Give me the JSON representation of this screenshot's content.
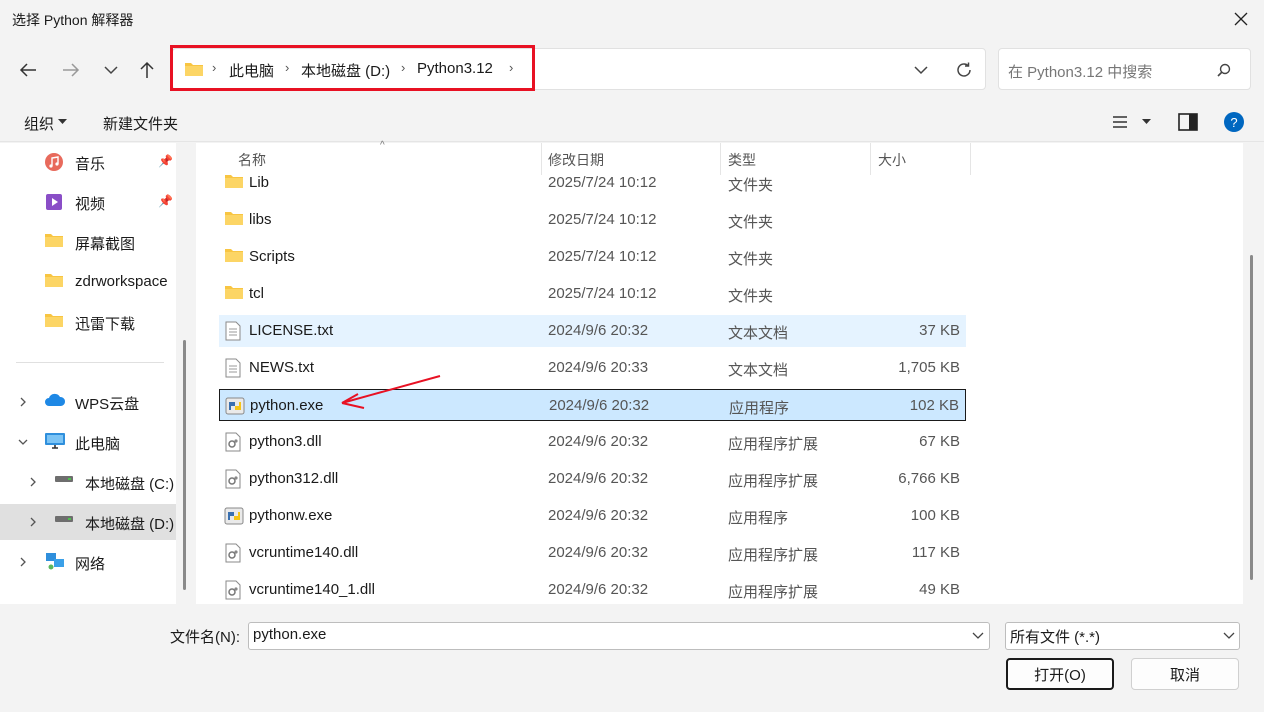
{
  "window": {
    "title": "选择 Python 解释器"
  },
  "breadcrumb": [
    "此电脑",
    "本地磁盘 (D:)",
    "Python3.12"
  ],
  "search": {
    "placeholder": "在 Python3.12 中搜索"
  },
  "toolbar": {
    "organize": "组织",
    "new_folder": "新建文件夹"
  },
  "nav": {
    "items": [
      {
        "label": "音乐",
        "icon": "music-icon",
        "pinned": true
      },
      {
        "label": "视频",
        "icon": "video-icon",
        "pinned": true
      },
      {
        "label": "屏幕截图",
        "icon": "folder-icon"
      },
      {
        "label": "zdrworkspace",
        "icon": "folder-icon"
      },
      {
        "label": "迅雷下载",
        "icon": "folder-icon"
      },
      {
        "label": "WPS云盘",
        "icon": "cloud-icon",
        "expandable": true
      },
      {
        "label": "此电脑",
        "icon": "computer-icon",
        "expanded": true
      },
      {
        "label": "本地磁盘 (C:)",
        "icon": "drive-icon",
        "expandable": true
      },
      {
        "label": "本地磁盘 (D:)",
        "icon": "drive-icon",
        "expandable": true,
        "selected": true
      },
      {
        "label": "网络",
        "icon": "network-icon",
        "expandable": true
      }
    ]
  },
  "columns": {
    "name": "名称",
    "date": "修改日期",
    "type": "类型",
    "size": "大小"
  },
  "files": [
    {
      "name": "Lib",
      "date": "2025/7/24 10:12",
      "type": "文件夹",
      "size": "",
      "icon": "folder-icon"
    },
    {
      "name": "libs",
      "date": "2025/7/24 10:12",
      "type": "文件夹",
      "size": "",
      "icon": "folder-icon"
    },
    {
      "name": "Scripts",
      "date": "2025/7/24 10:12",
      "type": "文件夹",
      "size": "",
      "icon": "folder-icon"
    },
    {
      "name": "tcl",
      "date": "2025/7/24 10:12",
      "type": "文件夹",
      "size": "",
      "icon": "folder-icon"
    },
    {
      "name": "LICENSE.txt",
      "date": "2024/9/6 20:32",
      "type": "文本文档",
      "size": "37 KB",
      "icon": "text-file-icon"
    },
    {
      "name": "NEWS.txt",
      "date": "2024/9/6 20:33",
      "type": "文本文档",
      "size": "1,705 KB",
      "icon": "text-file-icon"
    },
    {
      "name": "python.exe",
      "date": "2024/9/6 20:32",
      "type": "应用程序",
      "size": "102 KB",
      "icon": "python-icon"
    },
    {
      "name": "python3.dll",
      "date": "2024/9/6 20:32",
      "type": "应用程序扩展",
      "size": "67 KB",
      "icon": "dll-icon"
    },
    {
      "name": "python312.dll",
      "date": "2024/9/6 20:32",
      "type": "应用程序扩展",
      "size": "6,766 KB",
      "icon": "dll-icon"
    },
    {
      "name": "pythonw.exe",
      "date": "2024/9/6 20:32",
      "type": "应用程序",
      "size": "100 KB",
      "icon": "python-icon"
    },
    {
      "name": "vcruntime140.dll",
      "date": "2024/9/6 20:32",
      "type": "应用程序扩展",
      "size": "117 KB",
      "icon": "dll-icon"
    },
    {
      "name": "vcruntime140_1.dll",
      "date": "2024/9/6 20:32",
      "type": "应用程序扩展",
      "size": "49 KB",
      "icon": "dll-icon"
    }
  ],
  "footer": {
    "filename_label": "文件名(N):",
    "filename_value": "python.exe",
    "filetype_value": "所有文件 (*.*)",
    "open_label": "打开(O)",
    "cancel_label": "取消"
  },
  "colors": {
    "highlight_red": "#e81123",
    "selected_row": "#cce8ff",
    "hover_row": "#e5f3ff",
    "folder": "#f8c542",
    "help": "#0067c0"
  }
}
